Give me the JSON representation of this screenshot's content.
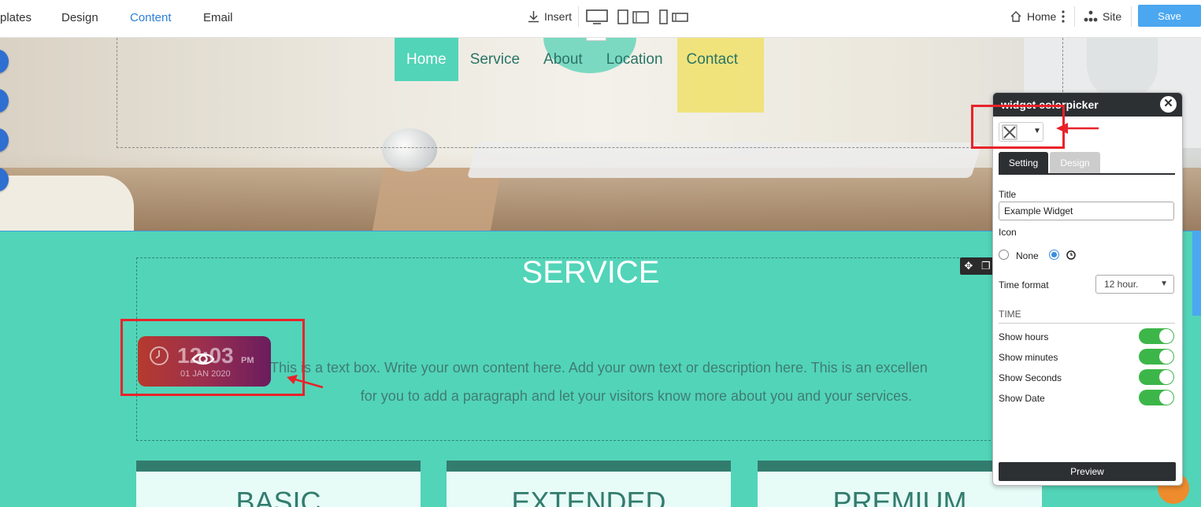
{
  "toolbar": {
    "tabs": [
      "plates",
      "Design",
      "Content",
      "Email"
    ],
    "insert_label": "Insert",
    "home_label": "Home",
    "site_label": "Site",
    "save_label": "Save"
  },
  "nav": {
    "items": [
      "Home",
      "Service",
      "About",
      "Location",
      "Contact"
    ]
  },
  "service": {
    "title": "SERVICE",
    "text_line1": "This is a text box. Write your own content here. Add your own text or description here. This is an excellen",
    "text_line2": "for you to add a paragraph and let your visitors know more about you and your services."
  },
  "clock": {
    "time": "12:03",
    "ampm": "PM",
    "date": "01 JAN 2020"
  },
  "cards": [
    "BASIC",
    "EXTENDED",
    "PREMIUM"
  ],
  "panel": {
    "title": "widget colorpicker",
    "tab_setting": "Setting",
    "tab_design": "Design",
    "title_label": "Title",
    "title_value": "Example Widget",
    "icon_label": "Icon",
    "icon_none": "None",
    "time_format_label": "Time format",
    "time_format_value": "12 hour.",
    "section_time": "TIME",
    "show_hours": "Show hours",
    "show_minutes": "Show minutes",
    "show_seconds": "Show Seconds",
    "show_date": "Show Date",
    "preview_label": "Preview"
  },
  "colors": {
    "accent": "#4aa7f0",
    "teal": "#52d4b8",
    "dark_teal": "#327c6e",
    "toggle_on": "#3cb649",
    "annotation_red": "#e8232a"
  }
}
